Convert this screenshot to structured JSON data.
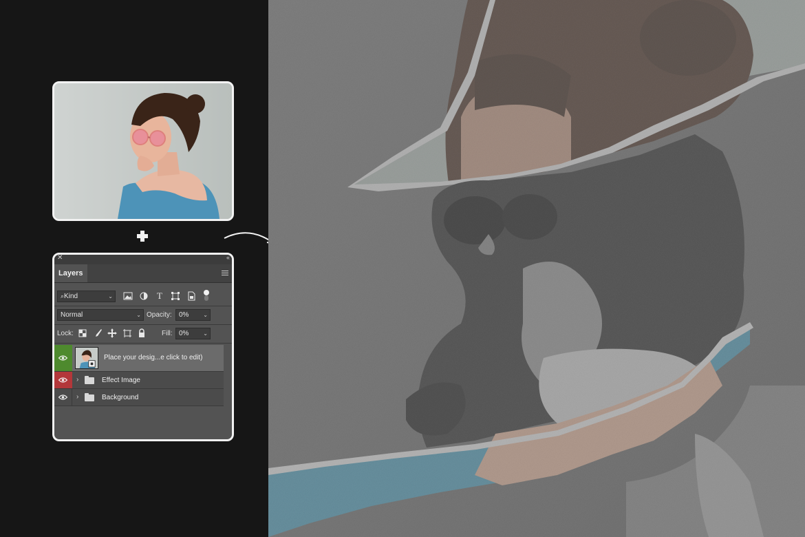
{
  "panel": {
    "tab_label": "Layers",
    "filter_kind": "Kind",
    "blend_mode": "Normal",
    "opacity_label": "Opacity:",
    "opacity_value": "0%",
    "lock_label": "Lock:",
    "fill_label": "Fill:",
    "fill_value": "0%",
    "layers": [
      {
        "name": "Place your desig...e click to edit)",
        "eye_color": "#4e8a2e",
        "selected": true
      },
      {
        "name": "Effect Image",
        "eye_color": "#b3373a",
        "selected": false
      },
      {
        "name": "Background",
        "eye_color": "#4b4b4b",
        "selected": false
      }
    ]
  },
  "colors": {
    "background": "#151515",
    "card_border": "#f2f2f2",
    "panel_bg": "#535353",
    "accent_green": "#4e8a2e",
    "accent_red": "#b3373a"
  }
}
